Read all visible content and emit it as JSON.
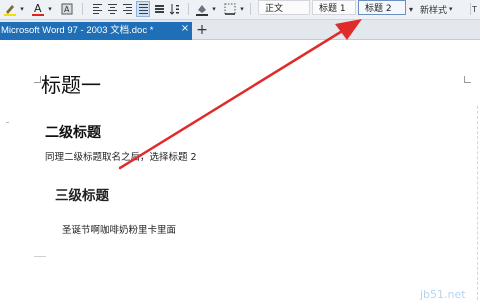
{
  "toolbar": {
    "styles": [
      {
        "label": "正文"
      },
      {
        "label": "标题 1"
      },
      {
        "label": "标题 2"
      }
    ],
    "new_style_label": "新样式",
    "new_style_chevron": "▾",
    "more_glyph": "▾",
    "icons": [
      "highlight-icon",
      "font-color-icon",
      "clear-format-icon",
      "align-left-icon",
      "align-center-icon",
      "align-right-icon",
      "justify-icon",
      "distributed-icon",
      "sort-icon",
      "shading-icon",
      "borders-icon"
    ]
  },
  "tabs": {
    "doc_tab_label": "Microsoft Word 97 - 2003 文档.doc *",
    "close_glyph": "×",
    "add_glyph": "+"
  },
  "document": {
    "heading1": "标题一",
    "heading2": "二级标题",
    "paragraph1": "同理二级标题取名之后，选择标题 2",
    "heading3": "三级标题",
    "paragraph2": "圣诞节啊咖啡奶粉里卡里面"
  },
  "watermark": "jb51.net",
  "colors": {
    "accent_tab": "#1f6fb8",
    "arrow": "#e02b2b"
  }
}
